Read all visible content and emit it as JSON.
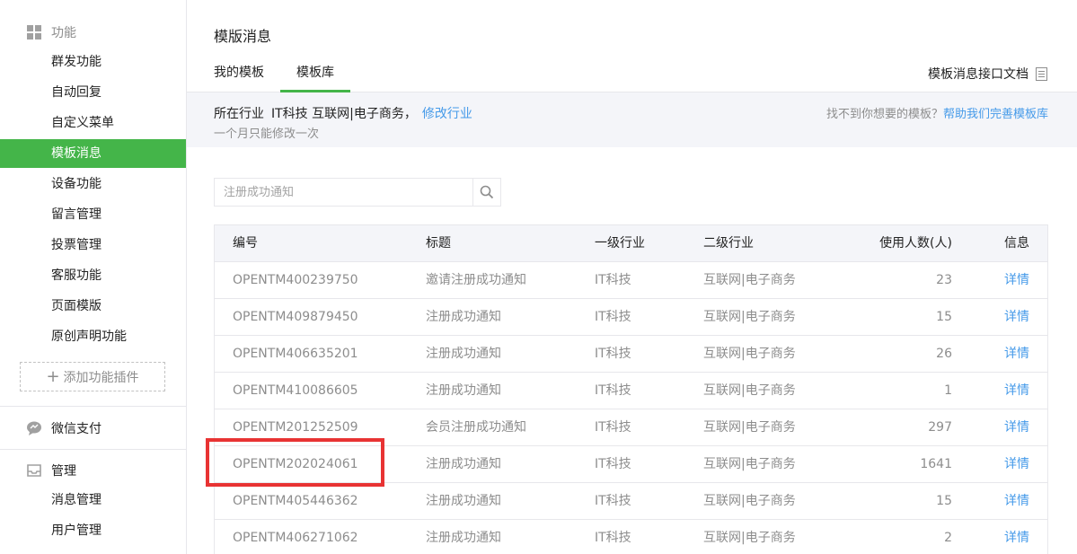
{
  "sidebar": {
    "function_section": {
      "label": "功能"
    },
    "function_items": [
      {
        "label": "群发功能"
      },
      {
        "label": "自动回复"
      },
      {
        "label": "自定义菜单"
      },
      {
        "label": "模板消息",
        "active": true
      },
      {
        "label": "设备功能"
      },
      {
        "label": "留言管理"
      },
      {
        "label": "投票管理"
      },
      {
        "label": "客服功能"
      },
      {
        "label": "页面模版"
      },
      {
        "label": "原创声明功能"
      }
    ],
    "add_plugin_label": "添加功能插件",
    "pay_section": {
      "label": "微信支付"
    },
    "manage_section": {
      "label": "管理"
    },
    "manage_items": [
      {
        "label": "消息管理"
      },
      {
        "label": "用户管理"
      }
    ]
  },
  "main": {
    "title": "模版消息",
    "tabs": [
      {
        "label": "我的模板"
      },
      {
        "label": "模板库",
        "active": true
      }
    ],
    "doc_link": "模板消息接口文档",
    "industry": {
      "prefix": "所在行业",
      "value": "IT科技 互联网|电子商务，",
      "edit_link": "修改行业",
      "note": "一个月只能修改一次",
      "help_text": "找不到你想要的模板？",
      "help_link": "帮助我们完善模板库"
    },
    "search": {
      "placeholder": "注册成功通知"
    },
    "table": {
      "headers": {
        "id": "编号",
        "title": "标题",
        "ind1": "一级行业",
        "ind2": "二级行业",
        "count": "使用人数(人)",
        "info": "信息"
      },
      "rows": [
        {
          "id": "OPENTM400239750",
          "title": "邀请注册成功通知",
          "ind1": "IT科技",
          "ind2": "互联网|电子商务",
          "count": "23",
          "info": "详情"
        },
        {
          "id": "OPENTM409879450",
          "title": "注册成功通知",
          "ind1": "IT科技",
          "ind2": "互联网|电子商务",
          "count": "15",
          "info": "详情"
        },
        {
          "id": "OPENTM406635201",
          "title": "注册成功通知",
          "ind1": "IT科技",
          "ind2": "互联网|电子商务",
          "count": "26",
          "info": "详情"
        },
        {
          "id": "OPENTM410086605",
          "title": "注册成功通知",
          "ind1": "IT科技",
          "ind2": "互联网|电子商务",
          "count": "1",
          "info": "详情"
        },
        {
          "id": "OPENTM201252509",
          "title": "会员注册成功通知",
          "ind1": "IT科技",
          "ind2": "互联网|电子商务",
          "count": "297",
          "info": "详情"
        },
        {
          "id": "OPENTM202024061",
          "title": "注册成功通知",
          "ind1": "IT科技",
          "ind2": "互联网|电子商务",
          "count": "1641",
          "info": "详情"
        },
        {
          "id": "OPENTM405446362",
          "title": "注册成功通知",
          "ind1": "IT科技",
          "ind2": "互联网|电子商务",
          "count": "15",
          "info": "详情"
        },
        {
          "id": "OPENTM406271062",
          "title": "注册成功通知",
          "ind1": "IT科技",
          "ind2": "互联网|电子商务",
          "count": "2",
          "info": "详情"
        }
      ]
    }
  },
  "colors": {
    "accent_green": "#44b549",
    "link_blue": "#459ae9",
    "highlight_red": "#e83333"
  }
}
